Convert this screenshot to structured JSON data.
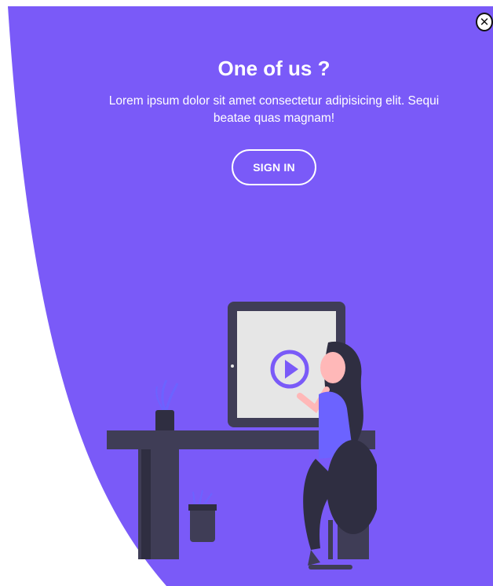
{
  "panel": {
    "color": "#7a5af8",
    "title": "One of us ?",
    "text": "Lorem ipsum dolor sit amet consectetur adipisicing elit. Sequi beatae quas magnam!",
    "button_label": "SIGN IN"
  },
  "close": {
    "icon": "close-icon",
    "glyph": "✕"
  },
  "illustration": {
    "icons": [
      "tablet-icon",
      "play-icon",
      "woman-figure",
      "desk-icon",
      "chair-icon",
      "plant-icon",
      "trash-bin-icon"
    ]
  }
}
